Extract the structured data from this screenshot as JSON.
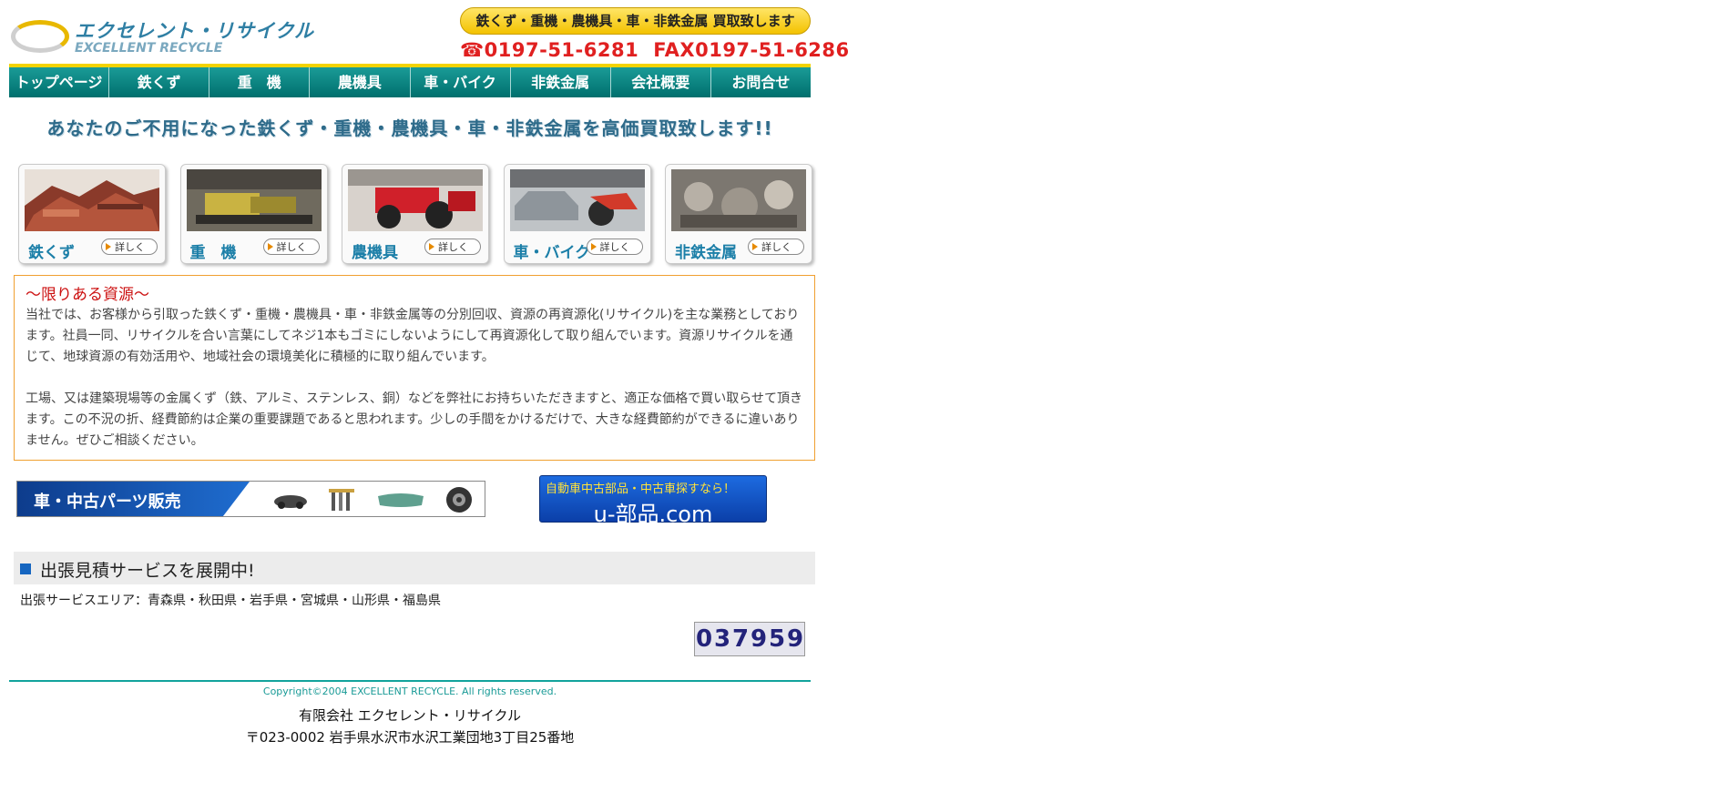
{
  "header": {
    "logo_jp": "エクセレント・リサイクル",
    "logo_en": "EXCELLENT RECYCLE",
    "pill_text": "鉄くず・重機・農機具・車・非鉄金属 買取致します",
    "tel": "☎0197-51-6281",
    "fax": "FAX0197-51-6286"
  },
  "nav": [
    "トップページ",
    "鉄くず",
    "重　機",
    "農機具",
    "車・バイク",
    "非鉄金属",
    "会社概要",
    "お問合せ"
  ],
  "headline": "あなたのご不用になった鉄くず・重機・農機具・車・非鉄金属を高価買取致します!!",
  "cards": [
    {
      "label": "鉄くず",
      "more": "詳しく"
    },
    {
      "label": "重　機",
      "more": "詳しく"
    },
    {
      "label": "農機具",
      "more": "詳しく"
    },
    {
      "label": "車・バイク",
      "more": "詳しく"
    },
    {
      "label": "非鉄金属",
      "more": "詳しく"
    }
  ],
  "info": {
    "title": "〜限りある資源〜",
    "p1": "当社では、お客様から引取った鉄くず・重機・農機具・車・非鉄金属等の分別回収、資源の再資源化(リサイクル)を主な業務としております。社員一同、リサイクルを合い言葉にしてネジ1本もゴミにしないようにして再資源化して取り組んでいます。資源リサイクルを通じて、地球資源の有効活用や、地域社会の環境美化に積極的に取り組んでいます。",
    "p2": "工場、又は建築現場等の金属くず（鉄、アルミ、ステンレス、銅）などを弊社にお持ちいただきますと、適正な価格で買い取らせて頂きます。この不況の折、経費節約は企業の重要課題であると思われます。少しの手間をかけるだけで、大きな経費節約ができるに違いありません。ぜひご相談ください。"
  },
  "banners": {
    "parts": "車・中古パーツ販売",
    "u_top": "自動車中古部品・中古車探すなら！",
    "u_main": "u-部品.com"
  },
  "service": {
    "title": "出張見積サービスを展開中!",
    "area": "出張サービスエリア：青森県・秋田県・岩手県・宮城県・山形県・福島県"
  },
  "counter": [
    "0",
    "3",
    "7",
    "9",
    "5",
    "9"
  ],
  "footer": {
    "copyright": "Copyright©2004 EXCELLENT RECYCLE. All rights reserved.",
    "company": "有限会社 エクセレント・リサイクル",
    "address": "〒023-0002 岩手県水沢市水沢工業団地3丁目25番地"
  },
  "colors": {
    "accent": "#1a9b97",
    "highlight": "#f4d300",
    "alert": "#cc1111",
    "phone": "#e02020"
  }
}
